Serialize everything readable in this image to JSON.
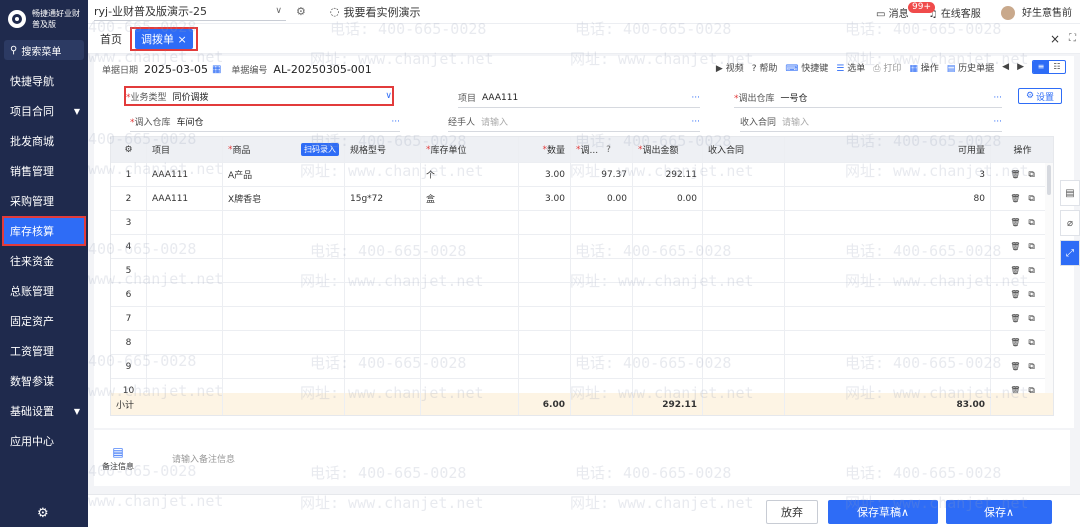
{
  "sidebar": {
    "logo_line1": "畅捷通好业财",
    "logo_line2": "普及版",
    "search_label": "搜索菜单",
    "items": [
      {
        "label": "快捷导航"
      },
      {
        "label": "项目合同",
        "caret": "▼"
      },
      {
        "label": "批发商城"
      },
      {
        "label": "销售管理"
      },
      {
        "label": "采购管理"
      },
      {
        "label": "库存核算"
      },
      {
        "label": "往来资金"
      },
      {
        "label": "总账管理"
      },
      {
        "label": "固定资产"
      },
      {
        "label": "工资管理"
      },
      {
        "label": "数智参谋"
      },
      {
        "label": "基础设置",
        "caret": "▼"
      },
      {
        "label": "应用中心"
      }
    ],
    "active_index": 5
  },
  "topbar": {
    "account": "ryj-业财普及版演示-25",
    "demo_link": "我要看实例演示",
    "message_label": "消息",
    "message_badge": "99+",
    "service_label": "在线客服",
    "user_label": "好生意售前"
  },
  "tabs": {
    "home": "首页",
    "active": "调拨单",
    "active_close": "×",
    "close": "×",
    "fullscreen": "⛶"
  },
  "doc": {
    "date_label": "单据日期",
    "date_value": "2025-03-05",
    "no_label": "单据编号",
    "no_value": "AL-20250305-001",
    "actions": [
      "视频",
      "帮助",
      "快捷键",
      "选单",
      "打印",
      "操作",
      "历史单据"
    ]
  },
  "form": {
    "biz_type_label": "业务类型",
    "biz_type_value": "同价调拨",
    "project_label": "项目",
    "project_value": "AAA111",
    "out_wh_label": "调出仓库",
    "out_wh_value": "一号仓",
    "in_wh_label": "调入仓库",
    "in_wh_value": "车间仓",
    "handler_label": "经手人",
    "handler_placeholder": "请输入",
    "contract_label": "收入合同",
    "contract_placeholder": "请输入",
    "settings_label": "设置",
    "dots": "···"
  },
  "table": {
    "headers": {
      "item": "项目",
      "product": "商品",
      "scan": "扫码录入",
      "spec": "规格型号",
      "unit": "库存单位",
      "qty": "数量",
      "price": "调...",
      "amount": "调出金额",
      "contract": "收入合同",
      "avail": "可用量",
      "ops": "操作"
    },
    "rows": [
      {
        "no": "1",
        "item": "AAA111",
        "product": "A产品",
        "spec": "",
        "unit": "个",
        "qty": "3.00",
        "price": "97.37",
        "amount": "292.11",
        "contract": "",
        "avail": "3"
      },
      {
        "no": "2",
        "item": "AAA111",
        "product": "X牌香皂",
        "spec": "15g*72",
        "unit": "盒",
        "qty": "3.00",
        "price": "0.00",
        "amount": "0.00",
        "contract": "",
        "avail": "80"
      },
      {
        "no": "3"
      },
      {
        "no": "4"
      },
      {
        "no": "5"
      },
      {
        "no": "6"
      },
      {
        "no": "7"
      },
      {
        "no": "8"
      },
      {
        "no": "9"
      },
      {
        "no": "10"
      }
    ],
    "total": {
      "label": "小计",
      "qty": "6.00",
      "amount": "292.11",
      "avail": "83.00"
    }
  },
  "remarks": {
    "label": "备注信息",
    "placeholder": "请输入备注信息"
  },
  "footer": {
    "discard": "放弃",
    "save_draft": "保存草稿∧",
    "save": "保存∧"
  },
  "watermark": {
    "phone": "电话: 400-665-0028",
    "site": "网址: www.chanjet.net",
    "phone_short": "400-665-0028",
    "site_short": "www.chanjet.net"
  },
  "colors": {
    "primary": "#2e6cf6",
    "sidebar": "#1f2a4d",
    "highlight": "#e23b3b"
  }
}
